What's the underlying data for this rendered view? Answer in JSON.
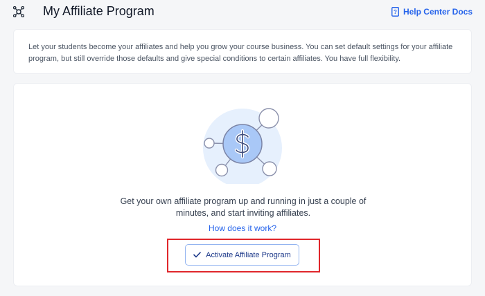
{
  "header": {
    "title": "My Affiliate Program",
    "help_link": "Help Center Docs",
    "title_icon": "affiliate-network-icon",
    "help_icon": "document-question-icon"
  },
  "intro": {
    "text": "Let your students become your affiliates and help you grow your course business. You can set default settings for your affiliate program, but still override those defaults and give special conditions to certain affiliates. You have full flexibility."
  },
  "main": {
    "illustration_icon": "dollar-network-illustration",
    "cta_text": "Get your own affiliate program up and running in just a couple of minutes, and start inviting affiliates.",
    "how_link": "How does it work?",
    "activate_button": "Activate Affiliate Program",
    "activate_icon": "check-icon"
  },
  "colors": {
    "link": "#2563eb",
    "highlight_border": "#e0262b",
    "button_border": "#93b4f0",
    "illustration_fill": "#a9c8f7"
  }
}
